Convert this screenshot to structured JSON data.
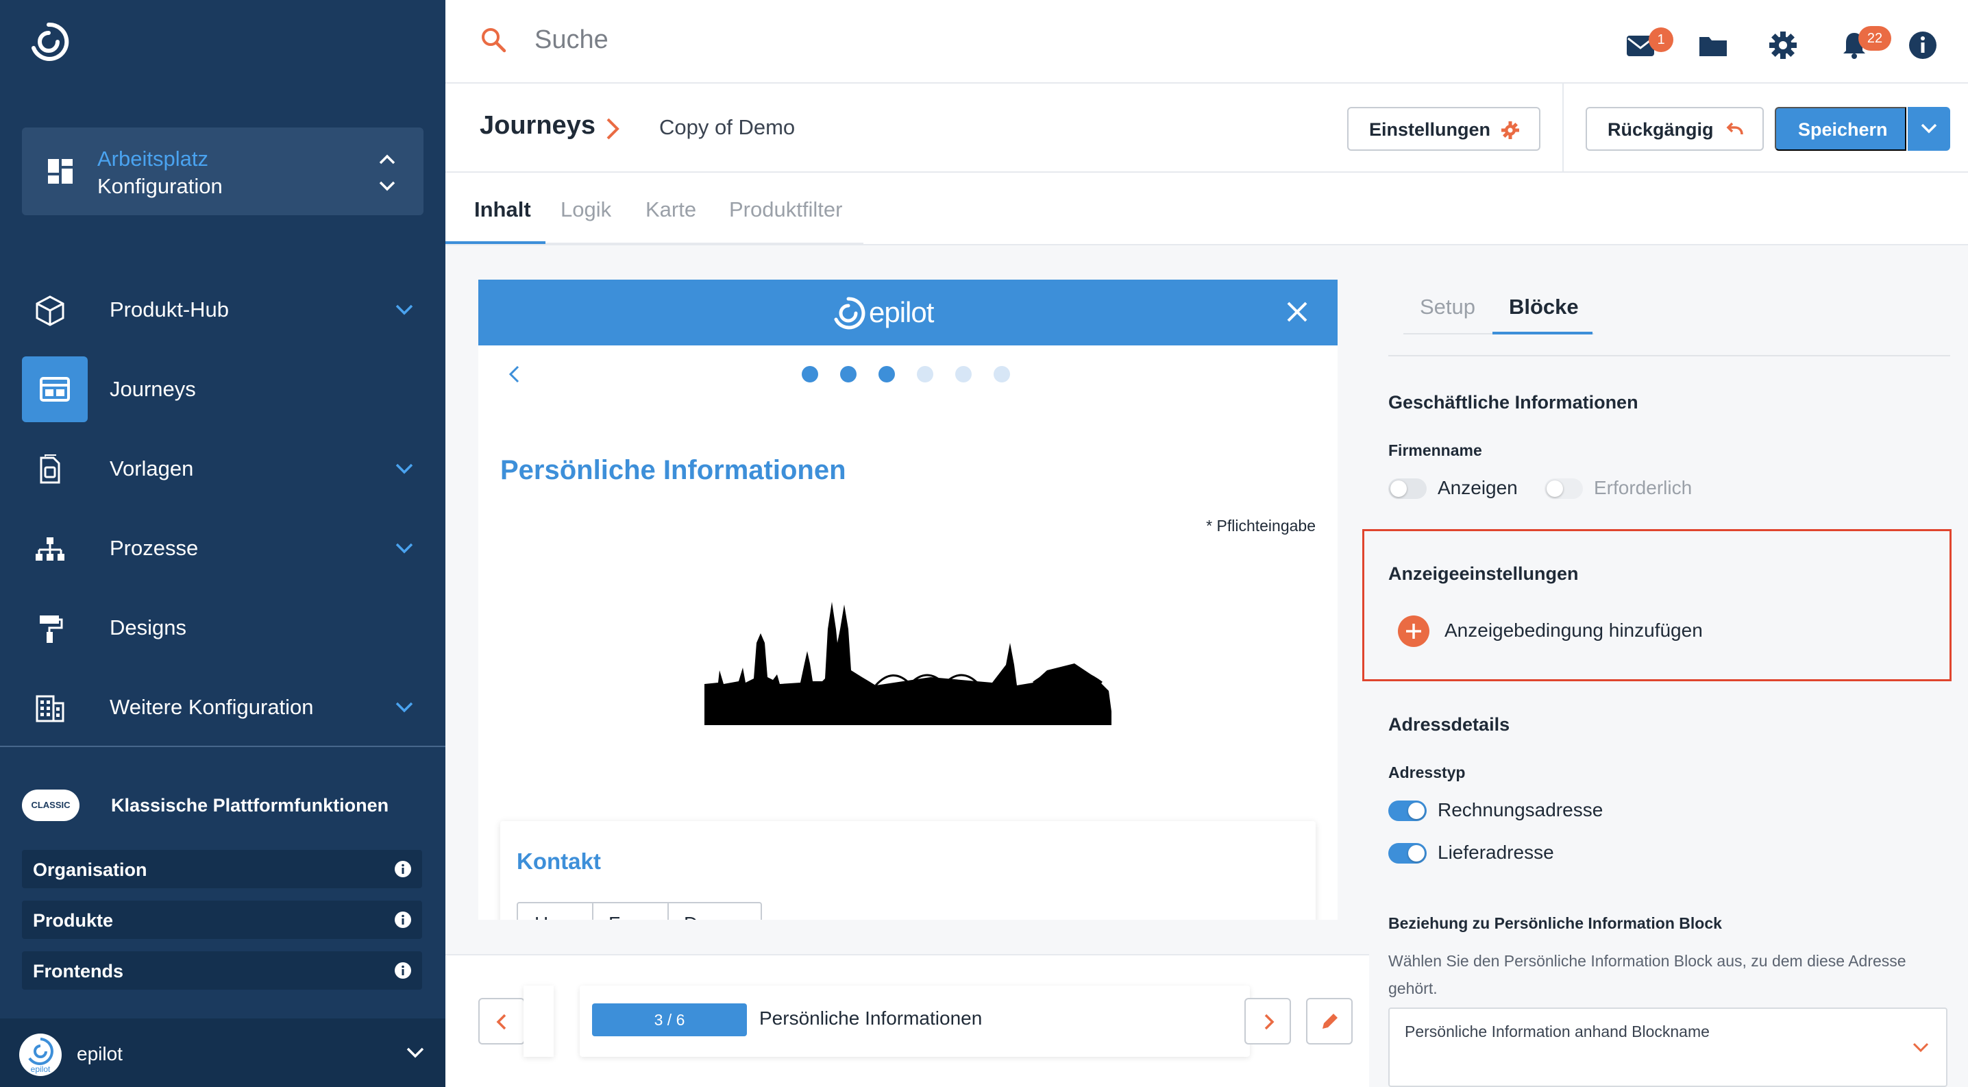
{
  "topbar": {
    "search_placeholder": "Suche",
    "mail_badge": "1",
    "notification_badge": "22"
  },
  "sidebar": {
    "workspace": {
      "label": "Arbeitsplatz",
      "value": "Konfiguration"
    },
    "items": [
      {
        "label": "Produkt-Hub",
        "icon": "cube-icon",
        "expandable": true
      },
      {
        "label": "Journeys",
        "icon": "journey-icon",
        "active": true
      },
      {
        "label": "Vorlagen",
        "icon": "document-icon",
        "expandable": true
      },
      {
        "label": "Prozesse",
        "icon": "hierarchy-icon",
        "expandable": true
      },
      {
        "label": "Designs",
        "icon": "paint-roller-icon"
      },
      {
        "label": "Weitere Konfiguration",
        "icon": "building-icon",
        "expandable": true
      }
    ],
    "classic": {
      "badge": "CLASSIC",
      "title": "Klassische Plattformfunktionen",
      "items": [
        "Organisation",
        "Produkte",
        "Frontends"
      ]
    },
    "footer": {
      "org_name": "epilot",
      "avatar_text": "epilot"
    }
  },
  "header": {
    "title": "Journeys",
    "subtitle": "Copy of Demo",
    "settings_button": "Einstellungen",
    "undo_button": "Rückgängig",
    "save_button": "Speichern"
  },
  "tabs": [
    "Inhalt",
    "Logik",
    "Karte",
    "Produktfilter"
  ],
  "preview": {
    "brand": "epilot",
    "steps_total": 6,
    "steps_done": 3,
    "page_title": "Persönliche Informationen",
    "required_note": "* Pflichteingabe",
    "card_title": "Kontakt",
    "salutation_options": [
      "H",
      "F",
      "D"
    ]
  },
  "pager": {
    "progress": "3 / 6",
    "step_label": "Persönliche Informationen"
  },
  "right_panel": {
    "tabs": [
      "Setup",
      "Blöcke"
    ],
    "business_heading": "Geschäftliche Informationen",
    "company_label": "Firmenname",
    "company_show": "Anzeigen",
    "company_required": "Erforderlich",
    "display_heading": "Anzeigeeinstellungen",
    "add_condition": "Anzeigebedingung hinzufügen",
    "address_heading": "Adressdetails",
    "address_type_label": "Adresstyp",
    "billing": "Rechnungsadresse",
    "delivery": "Lieferadresse",
    "relation_heading": "Beziehung zu Persönliche Information Block",
    "relation_desc": "Wählen Sie den Persönliche Information Block aus, zu dem diese Adresse gehört.",
    "relation_select": "Persönliche Information anhand Blockname"
  },
  "colors": {
    "sidebar_bg": "#1b3a5e",
    "accent_blue": "#3d8fd9",
    "accent_orange": "#ea6b43",
    "highlight_red": "#e0452e"
  }
}
